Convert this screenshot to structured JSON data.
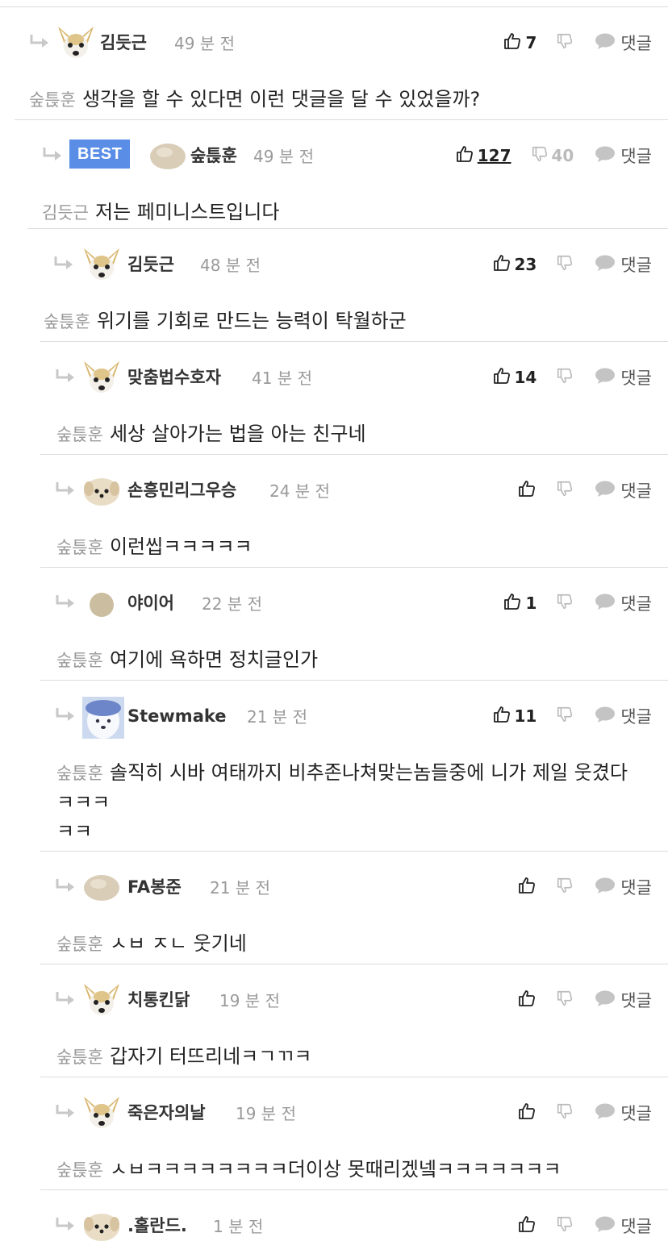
{
  "reply_label": "댓글",
  "best_label": "BEST",
  "comments": [
    {
      "author": "김듯근",
      "time": "49 분 전",
      "likes": "7",
      "dislikes": "",
      "mention": "숲튽훈",
      "text": "생각을 할 수 있다면 이런 댓글을 달 수 있었을까?",
      "avatar": "dog-avatar"
    },
    {
      "author": "숲튽훈",
      "time": "49 분 전",
      "likes": "127",
      "dislikes": "40",
      "mention": "김듯근",
      "text": "저는 페미니스트입니다",
      "avatar": "blob-avatar",
      "best": true
    },
    {
      "author": "김듯근",
      "time": "48 분 전",
      "likes": "23",
      "dislikes": "",
      "mention": "숲튽훈",
      "text": "위기를 기회로 만드는 능력이 탁월하군",
      "avatar": "dog-avatar"
    },
    {
      "author": "맞춤법수호자",
      "time": "41 분 전",
      "likes": "14",
      "dislikes": "",
      "mention": "숲튽훈",
      "text": "세상 살아가는 법을 아는 친구네",
      "avatar": "dog-avatar"
    },
    {
      "author": "손흥민리그우승",
      "time": "24 분 전",
      "likes": "",
      "dislikes": "",
      "mention": "숲튽훈",
      "text": "이런씹ㅋㅋㅋㅋㅋ",
      "avatar": "pup-avatar"
    },
    {
      "author": "야이어",
      "time": "22 분 전",
      "likes": "1",
      "dislikes": "",
      "mention": "숲튽훈",
      "text": "여기에 욕하면 정치글인가",
      "avatar": "circle-avatar"
    },
    {
      "author": "Stewmake",
      "time": "21 분 전",
      "likes": "11",
      "dislikes": "",
      "mention": "숲튽훈",
      "text": "솔직히 시바 여태까지 비추존나쳐맞는놈들중에 니가 제일 웃겼다 ㅋㅋㅋ\nㅋㅋ",
      "avatar": "photo-avatar"
    },
    {
      "author": "FA봉준",
      "time": "21 분 전",
      "likes": "",
      "dislikes": "",
      "mention": "숲튽훈",
      "text": "ㅅㅂ ㅈㄴ 웃기네",
      "avatar": "blob-avatar"
    },
    {
      "author": "치통킨닭",
      "time": "19 분 전",
      "likes": "",
      "dislikes": "",
      "mention": "숲튽훈",
      "text": "갑자기 터뜨리네ㅋㄱㄲㅋ",
      "avatar": "dog-avatar"
    },
    {
      "author": "죽은자의날",
      "time": "19 분 전",
      "likes": "",
      "dislikes": "",
      "mention": "숲튽훈",
      "text": "ㅅㅂㅋㅋㅋㅋㅋㅋㅋㅋ더이상 못때리겠넼ㅋㅋㅋㅋㅋㅋㅋ",
      "avatar": "dog-avatar"
    },
    {
      "author": ".홀란드.",
      "time": "1 분 전",
      "likes": "",
      "dislikes": "",
      "mention": "",
      "text": "",
      "avatar": "pup-avatar"
    }
  ]
}
